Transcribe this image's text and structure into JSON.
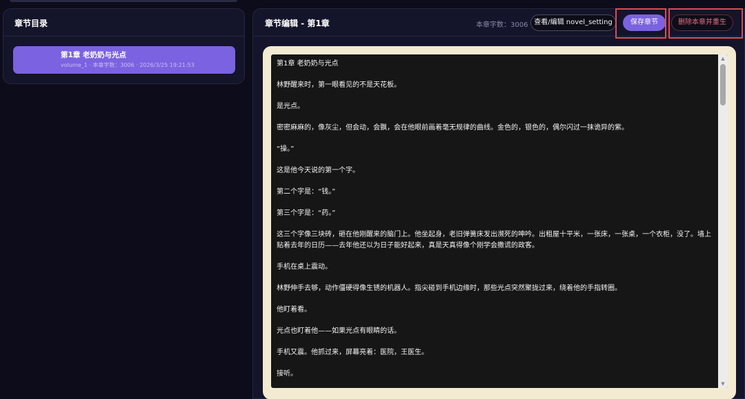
{
  "sidebar": {
    "title": "章节目录",
    "chapters": [
      {
        "title": "第1章 老奶奶与光点",
        "meta": "volume_1 · 本章字数：3006 · 2026/3/25 19:21:53"
      }
    ]
  },
  "editor": {
    "title": "章节编辑 - 第1章",
    "word_count": "本章字数：3006",
    "buttons": {
      "view": "查看/编辑 novel_setting",
      "save": "保存章节",
      "delete": "删除本章并重生"
    },
    "paragraphs": [
      "第1章 老奶奶与光点",
      "林野醒来时，第一眼看见的不是天花板。",
      "是光点。",
      "密密麻麻的，像灰尘，但会动，会飘，会在他眼前画着毫无规律的曲线。金色的，银色的，偶尔闪过一抹诡异的紫。",
      "“操。”",
      "这是他今天说的第一个字。",
      "第二个字是：“钱。”",
      "第三个字是：“药。”",
      "这三个字像三块砖，砸在他刚醒来的脑门上。他坐起身，老旧弹簧床发出濒死的呻吟。出租屋十平米，一张床，一张桌，一个衣柜，没了。墙上贴着去年的日历——去年他还以为日子能好起来，真是天真得像个刚学会撒谎的政客。",
      "手机在桌上震动。",
      "林野伸手去够，动作僵硬得像生锈的机器人。指尖碰到手机边缘时，那些光点突然聚拢过来，绕着他的手指转圈。",
      "他盯着看。",
      "光点也盯着他——如果光点有眼睛的话。",
      "手机又震。他抓过来，屏幕亮着：医院，王医生。",
      "接听。"
    ]
  },
  "scrollbar": {
    "up_arrow": "▲",
    "down_arrow": "▼"
  },
  "colors": {
    "accent": "#7b62e0",
    "danger": "#e07080",
    "highlight_box": "#e04a55",
    "editor_frame": "#f3ead2"
  }
}
